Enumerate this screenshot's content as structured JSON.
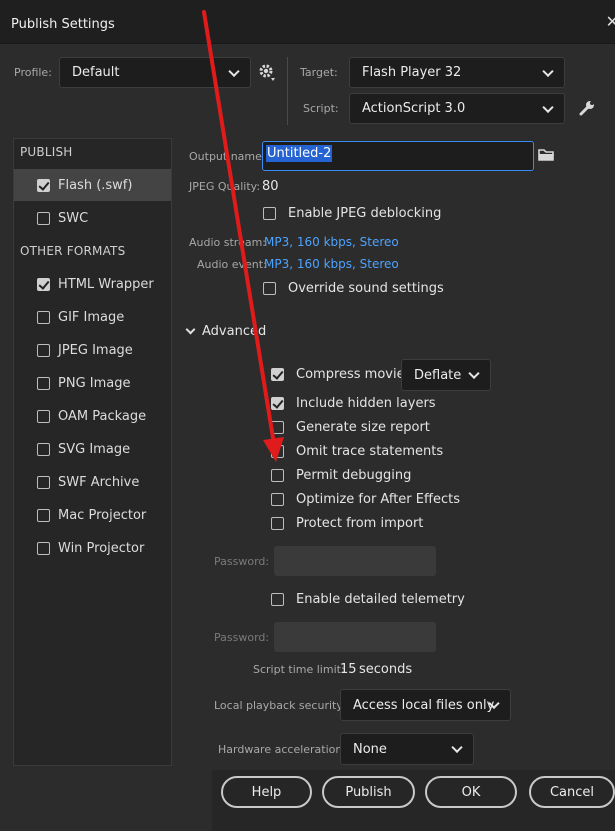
{
  "window": {
    "title": "Publish Settings",
    "close": "✕"
  },
  "top": {
    "profile_label": "Profile:",
    "profile_value": "Default",
    "target_label": "Target:",
    "target_value": "Flash Player 32",
    "script_label": "Script:",
    "script_value": "ActionScript 3.0"
  },
  "sidebar": {
    "publish_heading": "PUBLISH",
    "other_heading": "OTHER FORMATS",
    "publish_items": [
      {
        "label": "Flash (.swf)",
        "checked": true,
        "selected": true
      },
      {
        "label": "SWC",
        "checked": false
      }
    ],
    "other_items": [
      {
        "label": "HTML Wrapper",
        "checked": true
      },
      {
        "label": "GIF Image",
        "checked": false
      },
      {
        "label": "JPEG Image",
        "checked": false
      },
      {
        "label": "PNG Image",
        "checked": false
      },
      {
        "label": "OAM Package",
        "checked": false
      },
      {
        "label": "SVG Image",
        "checked": false
      },
      {
        "label": "SWF Archive",
        "checked": false
      },
      {
        "label": "Mac Projector",
        "checked": false
      },
      {
        "label": "Win Projector",
        "checked": false
      }
    ]
  },
  "main": {
    "output_label": "Output name:",
    "output_value": "Untitled-2",
    "jpeg_quality_label": "JPEG Quality:",
    "jpeg_quality_value": "80",
    "enable_jpeg_deblocking": "Enable JPEG deblocking",
    "audio_stream_label": "Audio stream:",
    "audio_stream_value": "MP3, 160 kbps, Stereo",
    "audio_event_label": "Audio event:",
    "audio_event_value": "MP3, 160 kbps, Stereo",
    "override_sound": "Override sound settings",
    "advanced_label": "Advanced",
    "advanced_options": [
      {
        "label": "Compress movie",
        "checked": true
      },
      {
        "label": "Include hidden layers",
        "checked": true
      },
      {
        "label": "Generate size report",
        "checked": false
      },
      {
        "label": "Omit trace statements",
        "checked": false
      },
      {
        "label": "Permit debugging",
        "checked": false
      },
      {
        "label": "Optimize for After Effects",
        "checked": false
      },
      {
        "label": "Protect from import",
        "checked": false
      }
    ],
    "compression_value": "Deflate",
    "password_label_1": "Password:",
    "enable_telemetry": "Enable detailed telemetry",
    "password_label_2": "Password:",
    "script_time_limit_label": "Script time limit:",
    "script_time_limit_value": "15",
    "seconds_label": "seconds",
    "local_playback_label": "Local playback security:",
    "local_playback_value": "Access local files only",
    "hw_accel_label": "Hardware acceleration:",
    "hw_accel_value": "None"
  },
  "buttons": {
    "help": "Help",
    "publish": "Publish",
    "ok": "OK",
    "cancel": "Cancel"
  },
  "colors": {
    "annotation_arrow": "#e01b1b",
    "link_blue": "#4da3ff",
    "selection": "#2463d1"
  }
}
